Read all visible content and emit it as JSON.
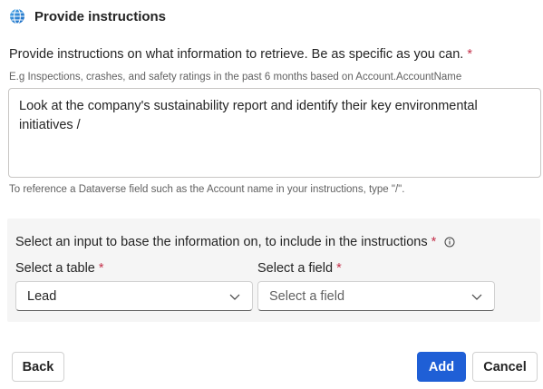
{
  "header": {
    "title": "Provide instructions",
    "icon": "globe-icon"
  },
  "instructions": {
    "label": "Provide instructions on what information to retrieve. Be as specific as you can.",
    "required_mark": "*",
    "example": "E.g Inspections, crashes, and safety ratings in the past 6 months based on Account.AccountName",
    "value": "Look at the company's sustainability report and identify their key environmental initiatives /",
    "hint": "To reference a Dataverse field such as the Account name in your instructions, type \"/\"."
  },
  "input_panel": {
    "title": "Select an input to base the information on, to include in the instructions",
    "required_mark": "*",
    "info_icon": "info-icon",
    "table": {
      "label": "Select a table",
      "required_mark": "*",
      "value": "Lead"
    },
    "field": {
      "label": "Select a field",
      "required_mark": "*",
      "placeholder": "Select a field"
    }
  },
  "footer": {
    "back_label": "Back",
    "add_label": "Add",
    "cancel_label": "Cancel"
  },
  "colors": {
    "primary": "#1f5fd6",
    "required": "#c4314b",
    "panel_bg": "#f5f5f5"
  }
}
